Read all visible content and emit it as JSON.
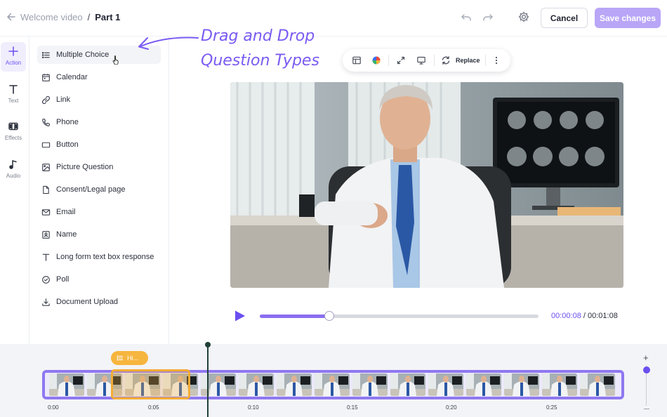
{
  "header": {
    "breadcrumb_parent": "Welcome video",
    "breadcrumb_separator": "/",
    "breadcrumb_current": "Part 1",
    "cancel_label": "Cancel",
    "save_label": "Save changes"
  },
  "rail": {
    "items": [
      {
        "label": "Action",
        "icon": "plus-icon",
        "active": true
      },
      {
        "label": "Text",
        "icon": "text-icon",
        "active": false
      },
      {
        "label": "Effects",
        "icon": "effects-icon",
        "active": false
      },
      {
        "label": "Audio",
        "icon": "music-note-icon",
        "active": false
      }
    ]
  },
  "questions": {
    "items": [
      {
        "label": "Multiple Choice",
        "icon": "list-icon",
        "active": true
      },
      {
        "label": "Calendar",
        "icon": "calendar-icon"
      },
      {
        "label": "Link",
        "icon": "link-icon"
      },
      {
        "label": "Phone",
        "icon": "phone-icon"
      },
      {
        "label": "Button",
        "icon": "button-icon"
      },
      {
        "label": "Picture Question",
        "icon": "image-icon"
      },
      {
        "label": "Consent/Legal page",
        "icon": "document-icon"
      },
      {
        "label": "Email",
        "icon": "mail-icon"
      },
      {
        "label": "Name",
        "icon": "contact-card-icon"
      },
      {
        "label": "Long form text box response",
        "icon": "text-icon"
      },
      {
        "label": "Poll",
        "icon": "check-circle-icon"
      },
      {
        "label": "Document Upload",
        "icon": "download-icon"
      }
    ]
  },
  "annotation": {
    "line1": "Drag and Drop",
    "line2": "Question Types"
  },
  "toolbar": {
    "replace_label": "Replace"
  },
  "player": {
    "current_time": "00:00:08",
    "separator": " / ",
    "total_time": "00:01:08",
    "progress": 0.25
  },
  "timeline": {
    "chip_label": "Hi...",
    "ticks": [
      "0:00",
      "0:05",
      "0:10",
      "0:15",
      "0:20",
      "0:25"
    ]
  },
  "colors": {
    "accent": "#6b4ef0",
    "accent_light": "#b9a6f7",
    "highlight": "#f6b53e"
  }
}
